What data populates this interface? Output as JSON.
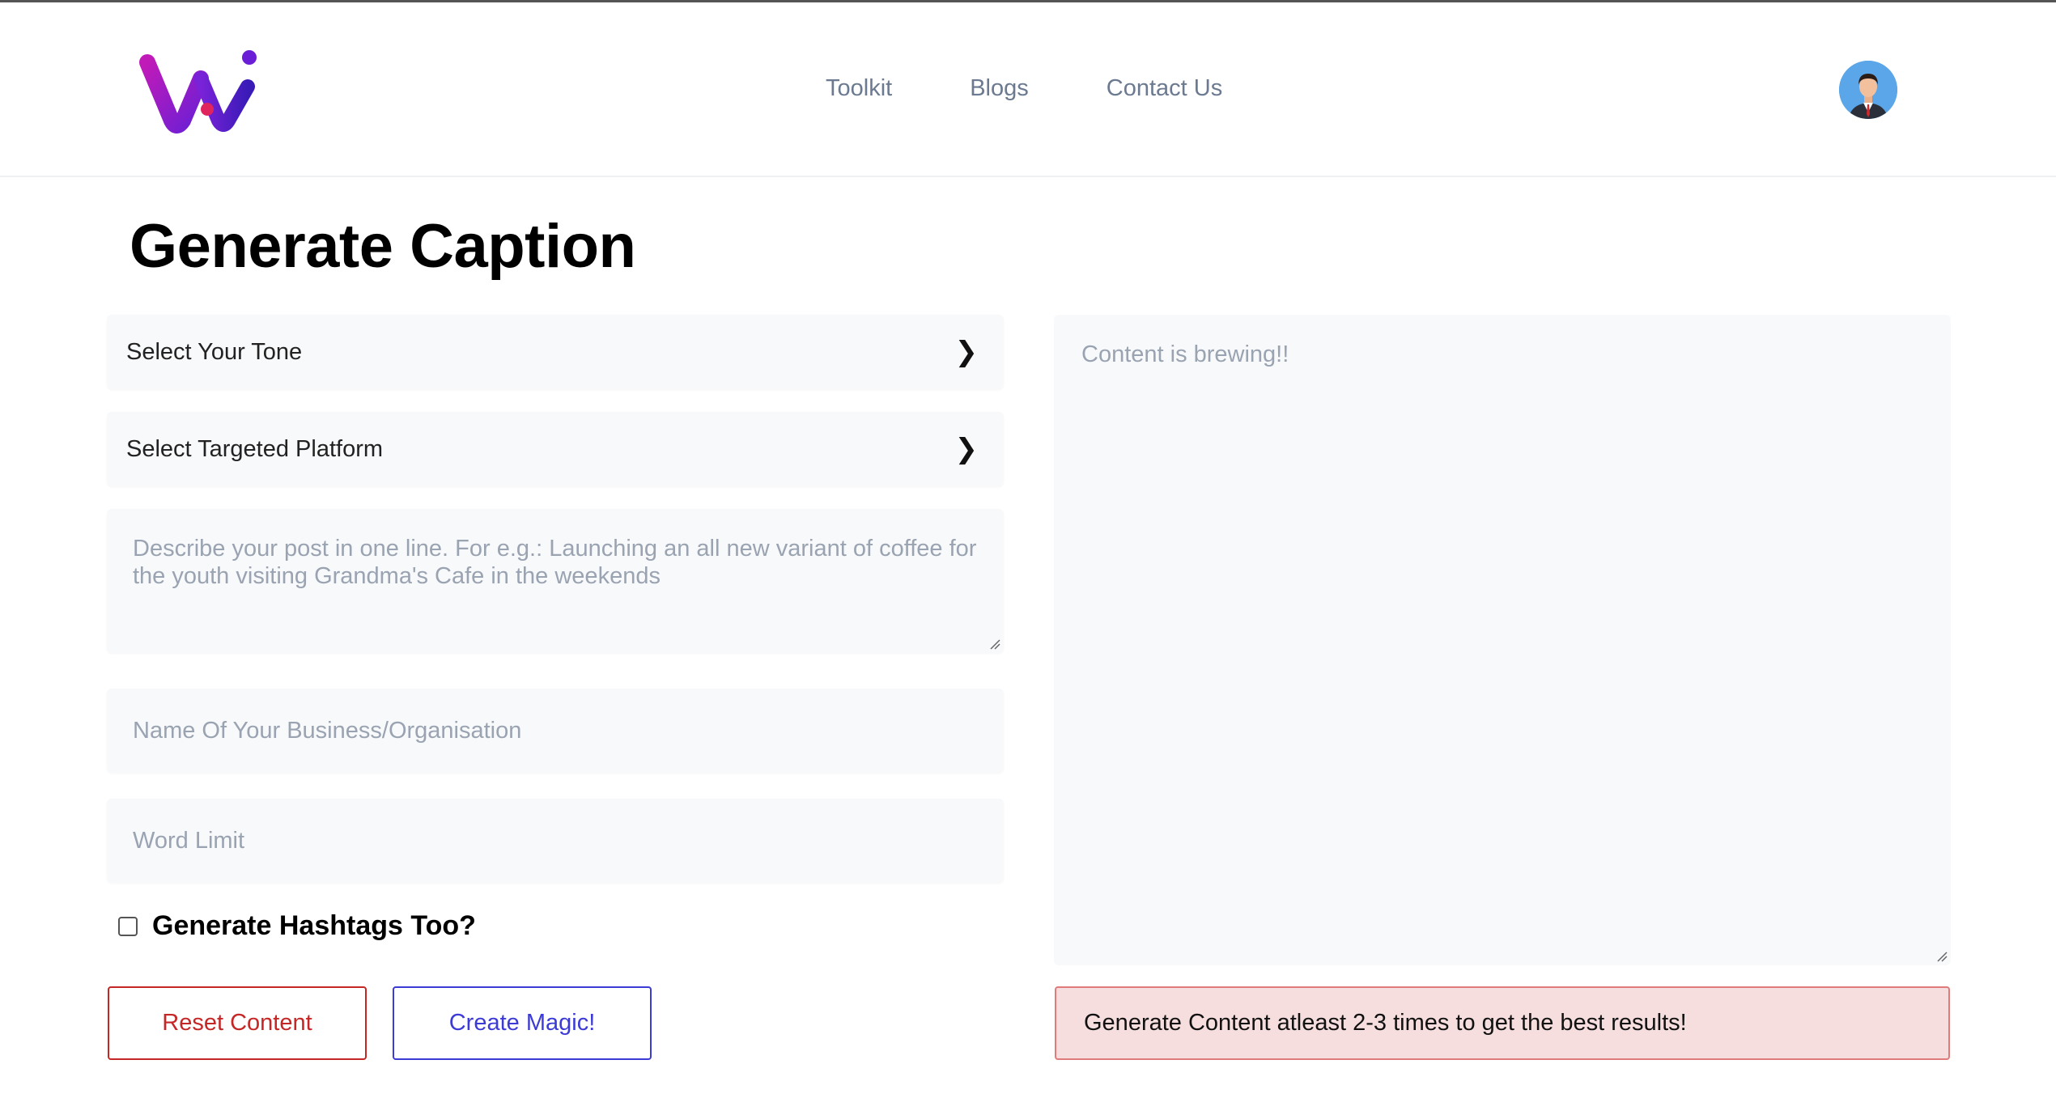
{
  "header": {
    "logo_alt": "WAI logo",
    "nav": [
      {
        "label": "Toolkit"
      },
      {
        "label": "Blogs"
      },
      {
        "label": "Contact Us"
      }
    ]
  },
  "page_title": "Generate Caption",
  "form": {
    "tone_select": {
      "label": "Select Your Tone",
      "icon": "chevron-right-icon"
    },
    "platform_select": {
      "label": "Select Targeted Platform",
      "icon": "chevron-right-icon"
    },
    "description": {
      "placeholder": "Describe your post in one line. For e.g.: Launching an all new variant of coffee for the youth visiting Grandma's Cafe in the weekends",
      "value": ""
    },
    "business_name": {
      "placeholder": "Name Of Your Business/Organisation",
      "value": ""
    },
    "word_limit": {
      "placeholder": "Word Limit",
      "value": ""
    },
    "hashtags": {
      "label": "Generate Hashtags Too?",
      "checked": false
    },
    "reset_label": "Reset Content",
    "create_label": "Create Magic!"
  },
  "output": {
    "placeholder": "Content is brewing!!",
    "value": ""
  },
  "alert": {
    "text": "Generate Content atleast 2-3 times to get the best results!"
  },
  "colors": {
    "accent_red": "#c52626",
    "accent_blue": "#3c3bd6",
    "alert_bg": "#f6dede",
    "field_bg": "#f8f9fb"
  }
}
